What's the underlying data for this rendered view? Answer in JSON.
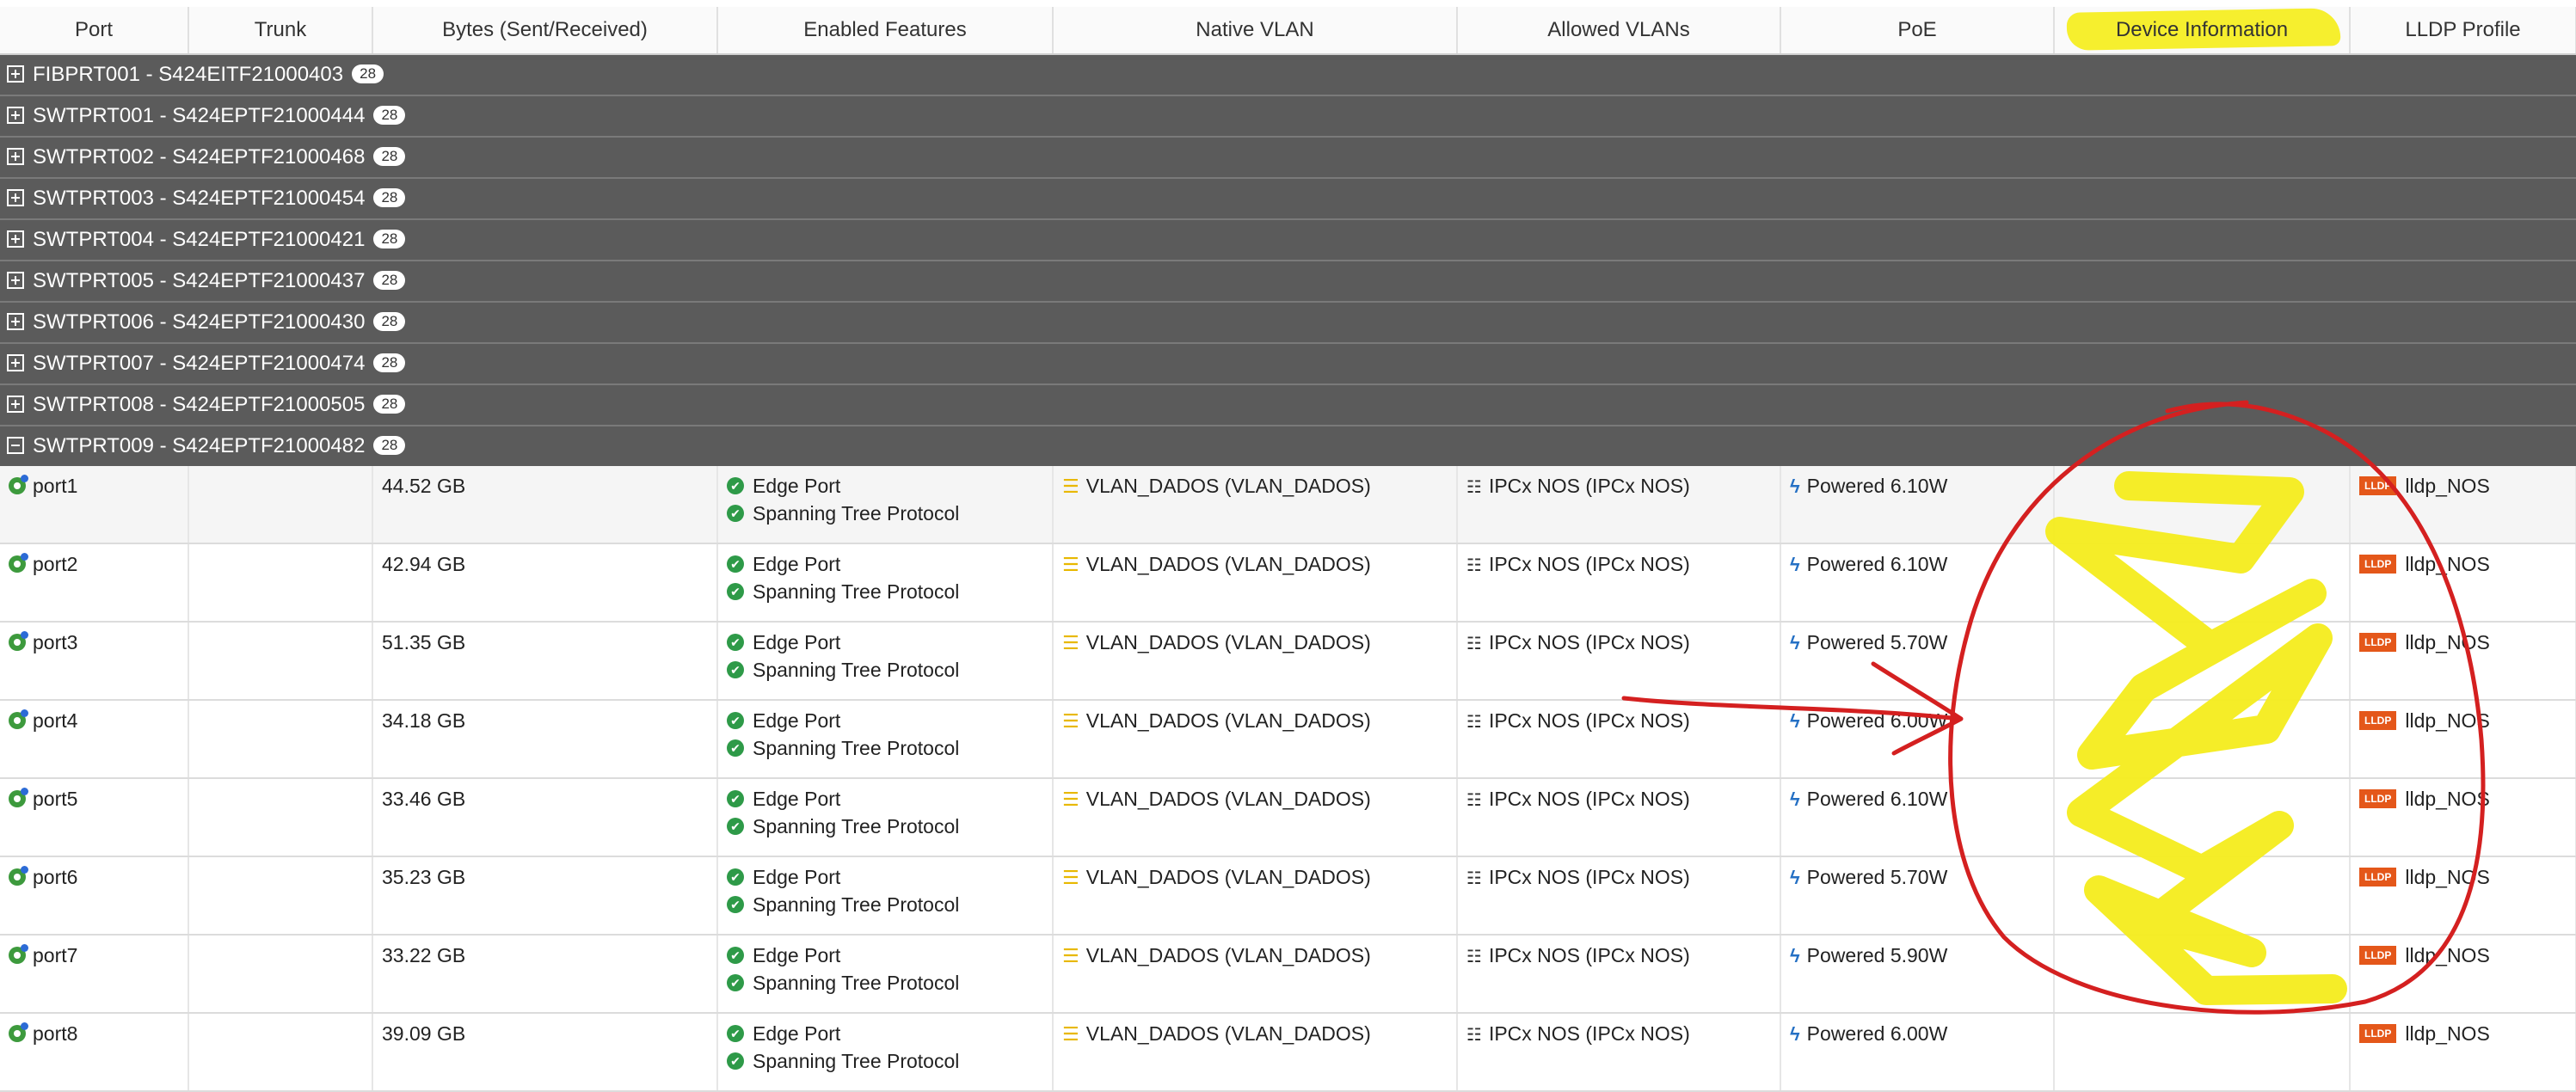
{
  "columns": [
    "Port",
    "Trunk",
    "Bytes (Sent/Received)",
    "Enabled Features",
    "Native VLAN",
    "Allowed VLANs",
    "PoE",
    "Device Information",
    "LLDP Profile"
  ],
  "groups": [
    {
      "label": "FIBPRT001 - S424EITF21000403",
      "count": "28"
    },
    {
      "label": "SWTPRT001 - S424EPTF21000444",
      "count": "28"
    },
    {
      "label": "SWTPRT002 - S424EPTF21000468",
      "count": "28"
    },
    {
      "label": "SWTPRT003 - S424EPTF21000454",
      "count": "28"
    },
    {
      "label": "SWTPRT004 - S424EPTF21000421",
      "count": "28"
    },
    {
      "label": "SWTPRT005 - S424EPTF21000437",
      "count": "28"
    },
    {
      "label": "SWTPRT006 - S424EPTF21000430",
      "count": "28"
    },
    {
      "label": "SWTPRT007 - S424EPTF21000474",
      "count": "28"
    },
    {
      "label": "SWTPRT008 - S424EPTF21000505",
      "count": "28"
    },
    {
      "label": "SWTPRT009 - S424EPTF21000482",
      "count": "28"
    }
  ],
  "features": [
    "Edge Port",
    "Spanning Tree Protocol"
  ],
  "lldp_badge": "LLDP",
  "ports": [
    {
      "port": "port1",
      "trunk": "",
      "bytes": "44.52 GB",
      "native_vlan": "VLAN_DADOS (VLAN_DADOS)",
      "allowed_vlans": "IPCx NOS (IPCx NOS)",
      "poe": "Powered 6.10W",
      "device_info": "",
      "lldp": "lldp_NOS"
    },
    {
      "port": "port2",
      "trunk": "",
      "bytes": "42.94 GB",
      "native_vlan": "VLAN_DADOS (VLAN_DADOS)",
      "allowed_vlans": "IPCx NOS (IPCx NOS)",
      "poe": "Powered 6.10W",
      "device_info": "",
      "lldp": "lldp_NOS"
    },
    {
      "port": "port3",
      "trunk": "",
      "bytes": "51.35 GB",
      "native_vlan": "VLAN_DADOS (VLAN_DADOS)",
      "allowed_vlans": "IPCx NOS (IPCx NOS)",
      "poe": "Powered 5.70W",
      "device_info": "",
      "lldp": "lldp_NOS"
    },
    {
      "port": "port4",
      "trunk": "",
      "bytes": "34.18 GB",
      "native_vlan": "VLAN_DADOS (VLAN_DADOS)",
      "allowed_vlans": "IPCx NOS (IPCx NOS)",
      "poe": "Powered 6.00W",
      "device_info": "",
      "lldp": "lldp_NOS"
    },
    {
      "port": "port5",
      "trunk": "",
      "bytes": "33.46 GB",
      "native_vlan": "VLAN_DADOS (VLAN_DADOS)",
      "allowed_vlans": "IPCx NOS (IPCx NOS)",
      "poe": "Powered 6.10W",
      "device_info": "",
      "lldp": "lldp_NOS"
    },
    {
      "port": "port6",
      "trunk": "",
      "bytes": "35.23 GB",
      "native_vlan": "VLAN_DADOS (VLAN_DADOS)",
      "allowed_vlans": "IPCx NOS (IPCx NOS)",
      "poe": "Powered 5.70W",
      "device_info": "",
      "lldp": "lldp_NOS"
    },
    {
      "port": "port7",
      "trunk": "",
      "bytes": "33.22 GB",
      "native_vlan": "VLAN_DADOS (VLAN_DADOS)",
      "allowed_vlans": "IPCx NOS (IPCx NOS)",
      "poe": "Powered 5.90W",
      "device_info": "",
      "lldp": "lldp_NOS"
    },
    {
      "port": "port8",
      "trunk": "",
      "bytes": "39.09 GB",
      "native_vlan": "VLAN_DADOS (VLAN_DADOS)",
      "allowed_vlans": "IPCx NOS (IPCx NOS)",
      "poe": "Powered 6.00W",
      "device_info": "",
      "lldp": "lldp_NOS"
    }
  ],
  "icons": {
    "expand": "plus-square-icon",
    "collapse": "minus-square-icon",
    "port": "port-status-icon",
    "feature": "check-circle-icon",
    "native_vlan": "vlan-icon",
    "allowed_vlans": "network-icon",
    "poe": "lightning-bolt-icon"
  },
  "colors": {
    "group_row_bg": "#5b5b5b",
    "highlight": "#f6ef2e",
    "annotation_red": "#d42020",
    "annotation_yellow": "#f4ec1c",
    "lldp_badge": "#e4571a",
    "check": "#2e9a48"
  }
}
